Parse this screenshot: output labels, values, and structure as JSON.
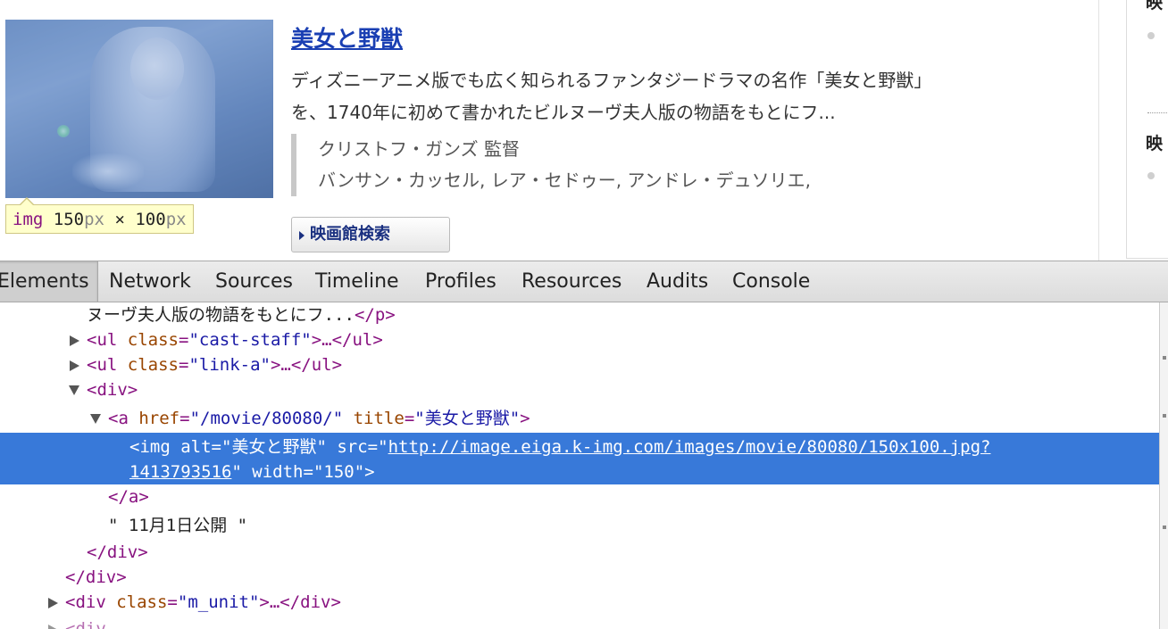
{
  "movie": {
    "title": "美女と野獣",
    "synopsis_line1": "ディズニーアニメ版でも広く知られるファンタジードラマの名作「美女と野獣」",
    "synopsis_line2": "を、1740年に初めて書かれたビルヌーヴ夫人版の物語をもとにフ...",
    "director": "クリストフ・ガンズ 監督",
    "cast": "バンサン・カッセル, レア・セドゥー, アンドレ・デュソリエ,",
    "search_button": "映画館検索"
  },
  "tooltip": {
    "tag": "img",
    "width": "150",
    "height": "100",
    "unit": "px",
    "times": "×"
  },
  "sidebar": {
    "heading1": "映",
    "heading2": "映"
  },
  "devtools": {
    "tabs": [
      "Elements",
      "Network",
      "Sources",
      "Timeline",
      "Profiles",
      "Resources",
      "Audits",
      "Console"
    ],
    "selected_tab": "Elements",
    "tree": {
      "l1_text": "ヌーヴ夫人版の物語をもとにフ...",
      "l1_close": "</p>",
      "l2_open": "<ul",
      "l2_attr": "class",
      "l2_val": "\"cast-staff\"",
      "l2_rest": ">…</ul>",
      "l3_open": "<ul",
      "l3_attr": "class",
      "l3_val": "\"link-a\"",
      "l3_rest": ">…</ul>",
      "l4_tag": "<div>",
      "l5_open": "<a",
      "l5_attr1": "href",
      "l5_val1": "\"/movie/80080/\"",
      "l5_attr2": "title",
      "l5_val2": "\"美女と野獣\"",
      "l5_close": ">",
      "sel_open": "<img",
      "sel_attr1": "alt",
      "sel_val1": "\"美女と野獣\"",
      "sel_attr2": "src",
      "sel_url1": "http://image.eiga.k-img.com/images/movie/80080/150x100.jpg?",
      "sel_url2": "1413793516",
      "sel_attr3": "width",
      "sel_val3": "\"150\"",
      "sel_close": ">",
      "l7_tag": "</a>",
      "l8_text": "\" 11月1日公開 \"",
      "l9_tag": "</div>",
      "l10_tag": "</div>",
      "l11_open": "<div",
      "l11_attr": "class",
      "l11_val": "\"m_unit\"",
      "l11_rest": ">…</div>"
    }
  }
}
